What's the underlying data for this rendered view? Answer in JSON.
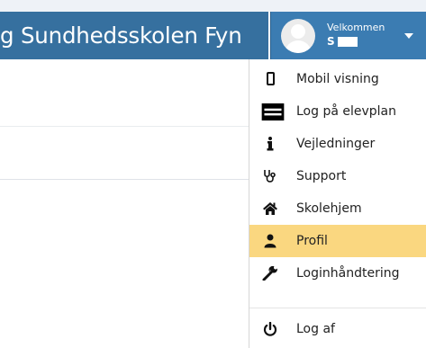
{
  "header": {
    "title": "g Sundhedsskolen Fyn"
  },
  "user": {
    "welcome": "Velkommen",
    "name": "S"
  },
  "menu": {
    "items": [
      {
        "label": "Mobil visning",
        "icon": "mobile-icon"
      },
      {
        "label": "Log på elevplan",
        "icon": "elevplan-logo-icon"
      },
      {
        "label": "Vejledninger",
        "icon": "info-icon"
      },
      {
        "label": "Support",
        "icon": "stethoscope-icon"
      },
      {
        "label": "Skolehjem",
        "icon": "home-icon"
      },
      {
        "label": "Profil",
        "icon": "user-icon",
        "active": true
      },
      {
        "label": "Loginhåndtering",
        "icon": "wrench-icon"
      }
    ],
    "logout": {
      "label": "Log af",
      "icon": "power-icon"
    }
  },
  "colors": {
    "header": "#36709f",
    "user_panel": "#3b7cb2",
    "active_item": "#fad780"
  }
}
